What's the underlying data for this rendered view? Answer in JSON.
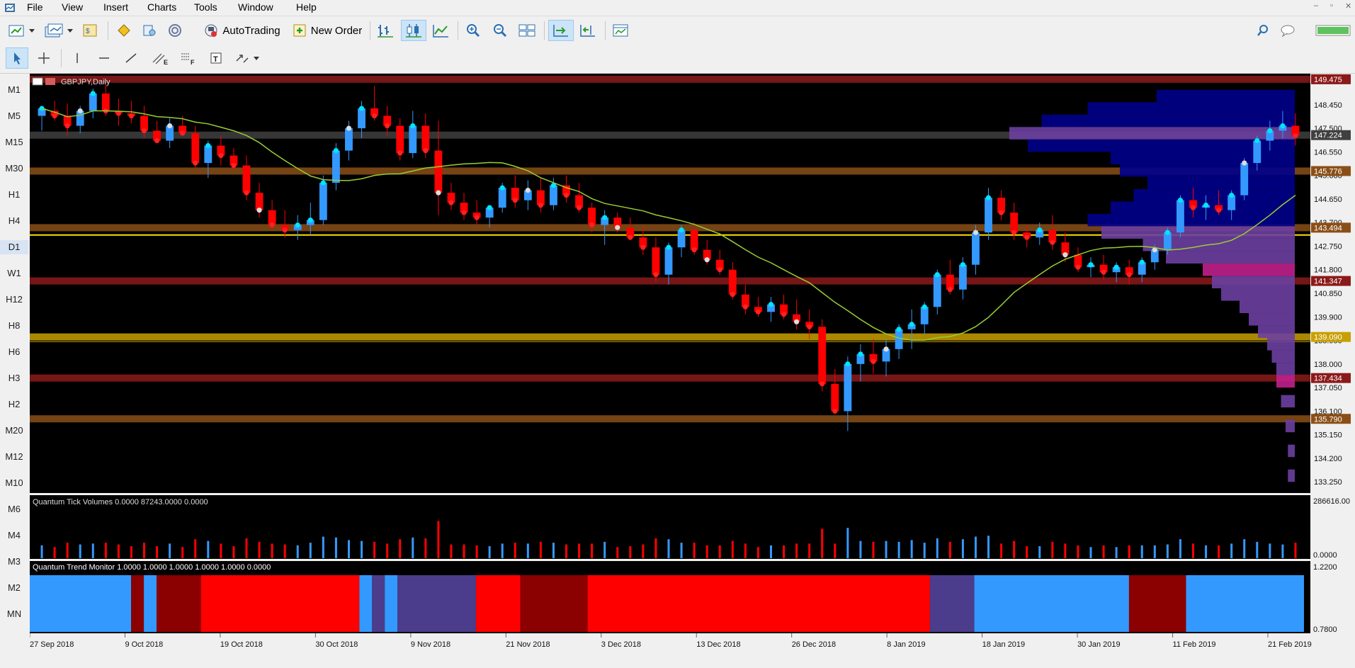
{
  "menu": [
    "File",
    "View",
    "Insert",
    "Charts",
    "Tools",
    "Window",
    "Help"
  ],
  "toolbar": {
    "autotrading": "AutoTrading",
    "new_order": "New Order"
  },
  "timeframes": [
    "M1",
    "M5",
    "M15",
    "M30",
    "H1",
    "H4",
    "D1",
    "W1",
    "H12",
    "H8",
    "H6",
    "H3",
    "H2",
    "M20",
    "M12",
    "M10",
    "M6",
    "M4",
    "M3",
    "M2",
    "MN"
  ],
  "selected_timeframe": "D1",
  "chart": {
    "symbol_label": "GBPJPY,Daily",
    "price_labels": [
      "148.450",
      "147.500",
      "146.550",
      "145.600",
      "144.650",
      "143.700",
      "142.750",
      "141.800",
      "140.850",
      "139.900",
      "138.950",
      "138.000",
      "137.050",
      "136.100",
      "135.150",
      "134.200",
      "133.250"
    ],
    "level_tags": [
      {
        "text": "149.475",
        "value": 149.475,
        "color": "#8b1a1a"
      },
      {
        "text": "147.224",
        "value": 147.224,
        "color": "#404040"
      },
      {
        "text": "145.776",
        "value": 145.776,
        "color": "#8a4f17"
      },
      {
        "text": "143.494",
        "value": 143.494,
        "color": "#8a4f17"
      },
      {
        "text": "141.347",
        "value": 141.347,
        "color": "#8b1a1a"
      },
      {
        "text": "139.090",
        "value": 139.09,
        "color": "#c8a000"
      },
      {
        "text": "137.434",
        "value": 137.434,
        "color": "#8b1a1a"
      },
      {
        "text": "135.790",
        "value": 135.79,
        "color": "#8a4f17"
      }
    ],
    "date_labels": [
      "27 Sep 2018",
      "9 Oct 2018",
      "19 Oct 2018",
      "30 Oct 2018",
      "9 Nov 2018",
      "21 Nov 2018",
      "3 Dec 2018",
      "13 Dec 2018",
      "26 Dec 2018",
      "8 Jan 2019",
      "18 Jan 2019",
      "30 Jan 2019",
      "11 Feb 2019",
      "21 Feb 2019"
    ]
  },
  "volume": {
    "label": "Quantum Tick Volumes 0.0000 87243.0000 0.0000",
    "scale_top": "286616.00",
    "scale_bottom": "0.0000"
  },
  "trend": {
    "label": "Quantum Trend Monitor 1.0000 1.0000 1.0000 1.0000 1.0000 0.0000",
    "scale_top": "1.2200",
    "scale_bottom": "0.7800"
  },
  "colors": {
    "bull": "#3399ff",
    "bear": "#ff0000",
    "ma": "#9acd32",
    "background": "#000000",
    "trend_purple": "#4b3c8c",
    "trend_dark": "#8b0000"
  },
  "chart_data": {
    "type": "candlestick",
    "ohlc_shape": [
      "open",
      "high",
      "low",
      "close"
    ],
    "candles": [
      [
        148.0,
        148.4,
        147.4,
        148.3
      ],
      [
        148.2,
        148.6,
        147.8,
        148.0
      ],
      [
        148.0,
        148.5,
        147.2,
        147.6
      ],
      [
        147.6,
        148.4,
        147.3,
        148.2
      ],
      [
        148.2,
        149.1,
        147.9,
        148.9
      ],
      [
        148.9,
        149.3,
        148.0,
        148.2
      ],
      [
        148.2,
        148.7,
        147.6,
        148.1
      ],
      [
        148.1,
        148.6,
        147.7,
        148.0
      ],
      [
        148.0,
        148.4,
        147.1,
        147.4
      ],
      [
        147.4,
        147.8,
        146.9,
        147.0
      ],
      [
        147.0,
        147.9,
        146.7,
        147.6
      ],
      [
        147.6,
        148.0,
        147.2,
        147.3
      ],
      [
        147.3,
        147.6,
        145.9,
        146.1
      ],
      [
        146.1,
        147.0,
        145.5,
        146.8
      ],
      [
        146.8,
        147.2,
        146.0,
        146.4
      ],
      [
        146.4,
        146.7,
        145.8,
        146.0
      ],
      [
        146.0,
        146.4,
        144.6,
        144.9
      ],
      [
        144.9,
        145.3,
        143.9,
        144.2
      ],
      [
        144.2,
        144.6,
        143.4,
        143.6
      ],
      [
        143.6,
        144.2,
        143.1,
        143.4
      ],
      [
        143.4,
        144.0,
        143.0,
        143.6
      ],
      [
        143.6,
        144.5,
        143.2,
        143.8
      ],
      [
        143.8,
        145.6,
        143.6,
        145.3
      ],
      [
        145.3,
        146.9,
        145.0,
        146.6
      ],
      [
        146.6,
        147.8,
        146.2,
        147.5
      ],
      [
        147.5,
        148.6,
        147.1,
        148.3
      ],
      [
        148.3,
        149.2,
        147.8,
        148.0
      ],
      [
        148.0,
        148.4,
        147.2,
        147.6
      ],
      [
        147.6,
        147.9,
        146.2,
        146.5
      ],
      [
        146.5,
        148.2,
        146.3,
        147.6
      ],
      [
        147.6,
        148.1,
        146.3,
        146.6
      ],
      [
        146.6,
        147.8,
        144.0,
        144.9
      ],
      [
        144.9,
        145.3,
        144.2,
        144.5
      ],
      [
        144.5,
        144.9,
        143.8,
        144.1
      ],
      [
        144.1,
        144.6,
        143.6,
        143.9
      ],
      [
        143.9,
        144.4,
        143.5,
        144.3
      ],
      [
        144.3,
        145.3,
        144.1,
        145.1
      ],
      [
        145.1,
        145.6,
        144.3,
        144.6
      ],
      [
        144.6,
        145.4,
        144.2,
        145.0
      ],
      [
        145.0,
        145.5,
        144.1,
        144.4
      ],
      [
        144.4,
        145.5,
        144.2,
        145.2
      ],
      [
        145.2,
        145.6,
        144.5,
        144.8
      ],
      [
        144.8,
        145.3,
        144.1,
        144.3
      ],
      [
        144.3,
        144.5,
        143.3,
        143.6
      ],
      [
        143.6,
        144.2,
        142.8,
        143.9
      ],
      [
        143.9,
        144.1,
        143.3,
        143.5
      ],
      [
        143.5,
        143.9,
        143.0,
        143.1
      ],
      [
        143.1,
        143.5,
        142.4,
        142.7
      ],
      [
        142.7,
        143.1,
        141.3,
        141.6
      ],
      [
        141.6,
        142.9,
        141.2,
        142.7
      ],
      [
        142.7,
        143.6,
        142.3,
        143.4
      ],
      [
        143.4,
        143.7,
        142.4,
        142.6
      ],
      [
        142.6,
        143.0,
        142.0,
        142.2
      ],
      [
        142.2,
        142.6,
        141.6,
        141.8
      ],
      [
        141.8,
        142.1,
        140.6,
        140.8
      ],
      [
        140.8,
        141.2,
        140.0,
        140.3
      ],
      [
        140.3,
        140.7,
        139.9,
        140.1
      ],
      [
        140.1,
        140.7,
        139.7,
        140.4
      ],
      [
        140.4,
        140.8,
        139.8,
        140.0
      ],
      [
        140.0,
        140.6,
        139.4,
        139.7
      ],
      [
        139.7,
        140.2,
        139.0,
        139.5
      ],
      [
        139.5,
        139.8,
        136.9,
        137.2
      ],
      [
        137.2,
        137.8,
        136.6,
        136.1
      ],
      [
        136.1,
        138.3,
        135.3,
        138.0
      ],
      [
        138.0,
        138.8,
        137.3,
        138.4
      ],
      [
        138.4,
        139.0,
        137.6,
        138.1
      ],
      [
        138.1,
        139.0,
        137.5,
        138.6
      ],
      [
        138.6,
        139.6,
        138.2,
        139.4
      ],
      [
        139.4,
        140.2,
        138.6,
        139.6
      ],
      [
        139.6,
        140.5,
        139.2,
        140.3
      ],
      [
        140.3,
        141.8,
        140.0,
        141.6
      ],
      [
        141.6,
        142.2,
        140.8,
        141.0
      ],
      [
        141.0,
        142.3,
        140.6,
        142.0
      ],
      [
        142.0,
        143.6,
        141.6,
        143.3
      ],
      [
        143.3,
        145.1,
        143.0,
        144.7
      ],
      [
        144.7,
        145.0,
        143.8,
        144.1
      ],
      [
        144.1,
        144.5,
        143.0,
        143.3
      ],
      [
        143.3,
        143.6,
        142.7,
        143.1
      ],
      [
        143.1,
        143.7,
        142.8,
        143.4
      ],
      [
        143.4,
        144.0,
        142.6,
        142.9
      ],
      [
        142.9,
        143.3,
        142.1,
        142.4
      ],
      [
        142.4,
        142.7,
        141.7,
        141.9
      ],
      [
        141.9,
        142.3,
        141.5,
        142.0
      ],
      [
        142.0,
        142.4,
        141.4,
        141.7
      ],
      [
        141.7,
        142.1,
        141.3,
        141.9
      ],
      [
        141.9,
        142.2,
        141.2,
        141.6
      ],
      [
        141.6,
        142.3,
        141.3,
        142.1
      ],
      [
        142.1,
        142.8,
        141.8,
        142.6
      ],
      [
        142.6,
        143.5,
        142.4,
        143.3
      ],
      [
        143.3,
        144.8,
        143.1,
        144.6
      ],
      [
        144.6,
        145.1,
        143.9,
        144.3
      ],
      [
        144.3,
        144.8,
        143.8,
        144.4
      ],
      [
        144.4,
        145.0,
        144.0,
        144.2
      ],
      [
        144.2,
        145.0,
        143.8,
        144.8
      ],
      [
        144.8,
        146.3,
        144.6,
        146.1
      ],
      [
        146.1,
        147.2,
        145.8,
        147.0
      ],
      [
        147.0,
        147.8,
        146.6,
        147.4
      ],
      [
        147.4,
        148.2,
        147.1,
        147.6
      ],
      [
        147.6,
        148.1,
        146.8,
        147.2
      ]
    ],
    "volume_max": 286616.0,
    "trend_segments": [
      {
        "color": "#3399ff",
        "share": 0.08
      },
      {
        "color": "#8b0000",
        "share": 0.01
      },
      {
        "color": "#3399ff",
        "share": 0.01
      },
      {
        "color": "#8b0000",
        "share": 0.035
      },
      {
        "color": "#ff0000",
        "share": 0.125
      },
      {
        "color": "#3399ff",
        "share": 0.01
      },
      {
        "color": "#4b3c8c",
        "share": 0.01
      },
      {
        "color": "#3399ff",
        "share": 0.01
      },
      {
        "color": "#4b3c8c",
        "share": 0.062
      },
      {
        "color": "#ff0000",
        "share": 0.035
      },
      {
        "color": "#8b0000",
        "share": 0.053
      },
      {
        "color": "#ff0000",
        "share": 0.27
      },
      {
        "color": "#4b3c8c",
        "share": 0.035
      },
      {
        "color": "#3399ff",
        "share": 0.122
      },
      {
        "color": "#8b0000",
        "share": 0.045
      },
      {
        "color": "#3399ff",
        "share": 0.093
      }
    ]
  }
}
